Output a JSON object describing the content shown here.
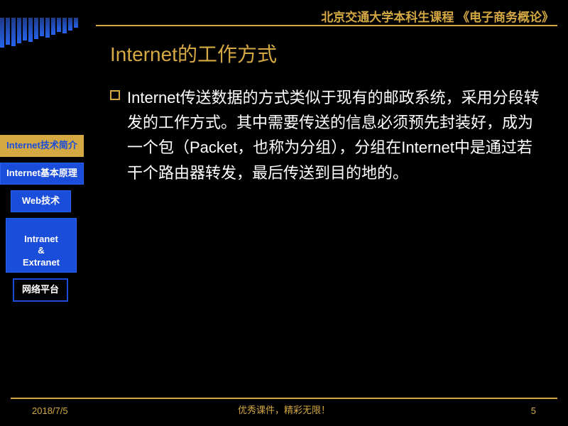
{
  "header": {
    "course": "北京交通大学本科生课程  《电子商务概论》"
  },
  "slide": {
    "title": "Internet的工作方式",
    "body": "Internet传送数据的方式类似于现有的邮政系统，采用分段转发的工作方式。其中需要传送的信息必须预先封装好，成为一个包（Packet，也称为分组），分组在Internet中是通过若干个路由器转发，最后传送到目的地的。"
  },
  "sidebar": {
    "items": [
      {
        "label": "Internet技术简介"
      },
      {
        "label": "Internet基本原理"
      },
      {
        "label": "Web技术"
      },
      {
        "label": "Intranet\n&\nExtranet"
      },
      {
        "label": "网络平台"
      }
    ]
  },
  "footer": {
    "date": "2018/7/5",
    "text": "优秀课件，精彩无限！",
    "page": "5"
  }
}
